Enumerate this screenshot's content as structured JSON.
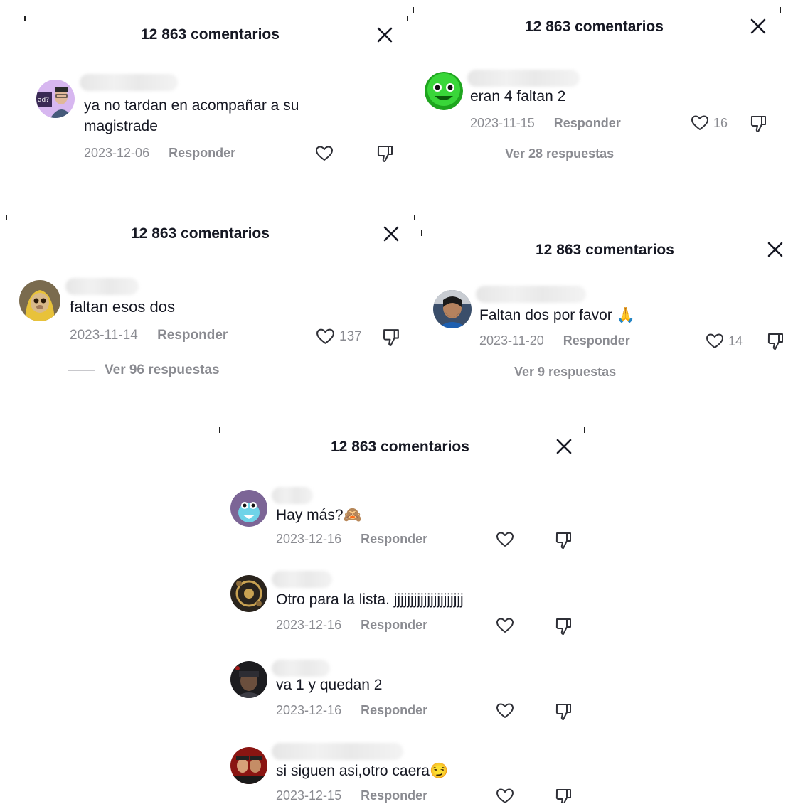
{
  "header_title": "12 863 comentarios",
  "reply_label": "Responder",
  "panels": {
    "p1": {
      "comment": {
        "text": "ya no tardan en acompañar a su magistrade",
        "date": "2023-12-06"
      }
    },
    "p2": {
      "comment": {
        "text": "eran 4 faltan 2",
        "date": "2023-11-15",
        "likes": "16"
      },
      "view_replies": "Ver 28 respuestas"
    },
    "p3": {
      "comment": {
        "text": "faltan esos dos",
        "date": "2023-11-14",
        "likes": "137"
      },
      "view_replies": "Ver 96 respuestas"
    },
    "p4": {
      "comment": {
        "text": "Faltan dos por favor 🙏",
        "date": "2023-11-20",
        "likes": "14"
      },
      "view_replies": "Ver 9 respuestas"
    },
    "p5": {
      "comments": [
        {
          "text": "Hay más?🙈",
          "date": "2023-12-16"
        },
        {
          "text": "Otro para la lista. jjjjjjjjjjjjjjjjjjjjj",
          "date": "2023-12-16"
        },
        {
          "text": "va 1 y quedan 2",
          "date": "2023-12-16"
        },
        {
          "text": "si siguen asi,otro caera😏",
          "date": "2023-12-15"
        }
      ]
    }
  },
  "icons": {
    "close": "close-icon",
    "like": "heart-outline-icon",
    "dislike": "thumbs-down-icon"
  },
  "colors": {
    "text_primary": "#161823",
    "text_secondary": "#8a8b91"
  }
}
